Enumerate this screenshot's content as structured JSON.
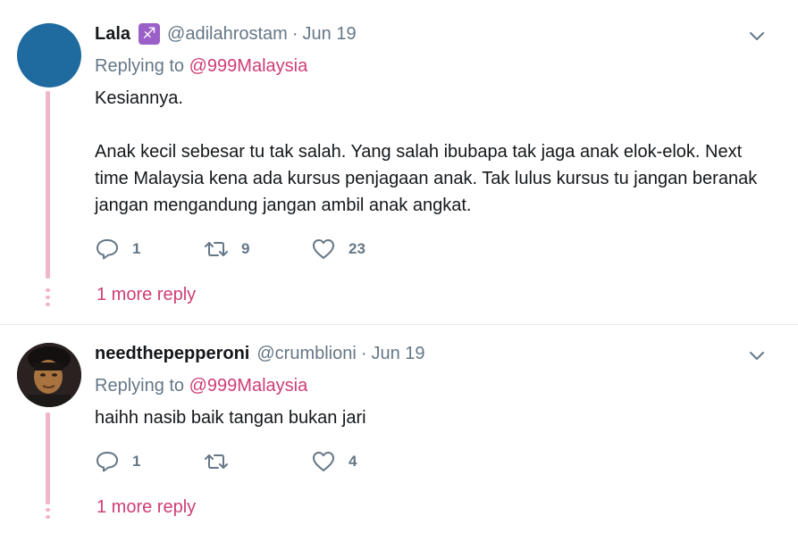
{
  "tweets": [
    {
      "fullname": "Lala",
      "badge_icon": "sagittarius-icon",
      "badge_glyph": "♐",
      "username": "@adilahrostam",
      "separator": "·",
      "time": "Jun 19",
      "replying_prefix": "Replying to",
      "replying_to": "@999Malaysia",
      "text": [
        "Kesiannya.",
        "Anak kecil sebesar tu tak salah. Yang salah ibubapa tak jaga anak elok-elok. Next time Malaysia kena ada kursus penjagaan anak. Tak lulus kursus tu jangan beranak jangan mengandung jangan ambil anak angkat."
      ],
      "replies": "1",
      "retweets": "9",
      "likes": "23",
      "more_replies": "1 more reply",
      "avatar_color": "#1f6ba0"
    },
    {
      "fullname": "needthepepperoni",
      "username": "@crumblioni",
      "separator": "·",
      "time": "Jun 19",
      "replying_prefix": "Replying to",
      "replying_to": "@999Malaysia",
      "text": [
        "haihh nasib baik tangan bukan jari"
      ],
      "replies": "1",
      "retweets": "",
      "likes": "4",
      "more_replies": "1 more reply",
      "avatar_color": "#2a2220"
    }
  ],
  "colors": {
    "accent": "#cf3d74",
    "muted": "#657786",
    "thread": "#f0b6c9",
    "text": "#14171a"
  }
}
